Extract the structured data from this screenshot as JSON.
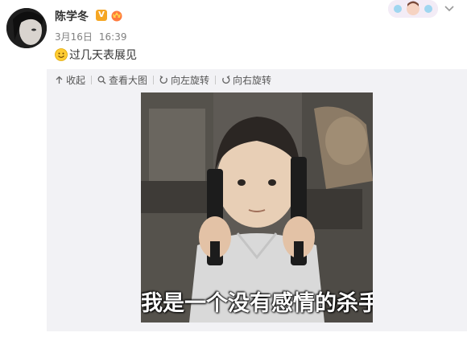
{
  "post": {
    "author": "陈学冬",
    "date": "3月16日",
    "time": "16:39",
    "text": "过几天表展见"
  },
  "toolbar": {
    "collapse_label": "收起",
    "view_large_label": "查看大图",
    "rotate_left_label": "向左旋转",
    "rotate_right_label": "向右旋转"
  },
  "image": {
    "caption": "我是一个没有感情的杀手"
  },
  "icons": {
    "verified": "v-badge-icon",
    "vip": "vip-crown-icon",
    "emoji": "smile-emoji-icon",
    "menu": "chevron-down-icon"
  },
  "colors": {
    "verified_badge": "#f5a623",
    "meta_text": "#808080",
    "media_background": "#f2f2f5"
  }
}
